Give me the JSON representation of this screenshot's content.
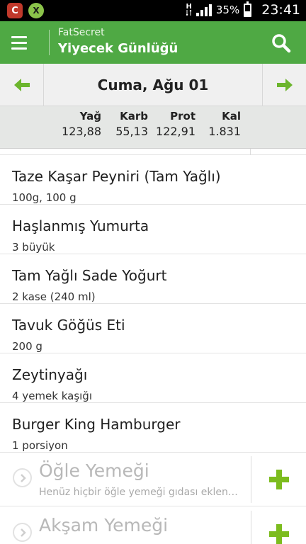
{
  "status_bar": {
    "app_icon_1": "C",
    "app_icon_2": "X",
    "network_label": "H",
    "battery_percent": "35%",
    "time": "23:41"
  },
  "header": {
    "app_name": "FatSecret",
    "title": "Yiyecek Günlüğü"
  },
  "date_nav": {
    "date": "Cuma, Ağu 01"
  },
  "summary": {
    "columns": [
      {
        "label": "Yağ",
        "value": "123,88"
      },
      {
        "label": "Karb",
        "value": "55,13"
      },
      {
        "label": "Prot",
        "value": "122,91"
      },
      {
        "label": "Kal",
        "value": "1.831"
      }
    ]
  },
  "foods": [
    {
      "name": "Taze Kaşar Peyniri (Tam Yağlı)",
      "portion": "100g, 100 g"
    },
    {
      "name": "Haşlanmış Yumurta",
      "portion": "3 büyük"
    },
    {
      "name": "Tam Yağlı Sade Yoğurt",
      "portion": "2 kase (240 ml)"
    },
    {
      "name": "Tavuk Göğüs Eti",
      "portion": "200 g"
    },
    {
      "name": "Zeytinyağı",
      "portion": "4 yemek kaşığı"
    },
    {
      "name": "Burger King Hamburger",
      "portion": "1 porsiyon"
    }
  ],
  "meals": [
    {
      "title": "Öğle Yemeği",
      "subtitle": "Henüz hiçbir öğle yemeği gıdası eklenmemi..."
    },
    {
      "title": "Akşam Yemeği",
      "subtitle": ""
    }
  ],
  "colors": {
    "brand_green": "#4fa944",
    "accent_green": "#7cbc1e"
  }
}
